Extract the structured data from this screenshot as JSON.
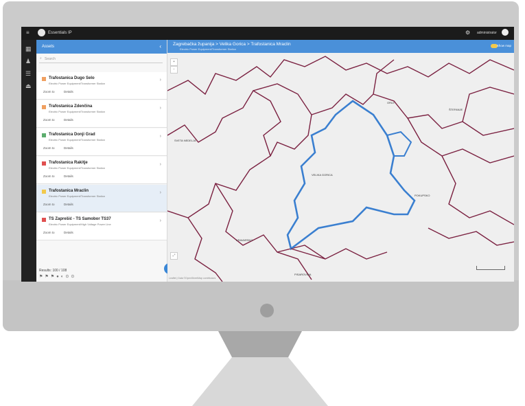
{
  "app": {
    "title": "Essentials IP",
    "user": "administrator"
  },
  "sidebar": {
    "title": "Assets",
    "search_placeholder": "Search",
    "items": [
      {
        "name": "Trafostanica Dugo Selo",
        "desc": "Electric Power Equipment/Transformer Station",
        "color": "#f0a060",
        "a1": "Zoom to",
        "a2": "Details"
      },
      {
        "name": "Trafostanica Zdenčina",
        "desc": "Electric Power Equipment/Transformer Station",
        "color": "#f0a060",
        "a1": "Zoom to",
        "a2": "Details"
      },
      {
        "name": "Trafostanica Donji Grad",
        "desc": "Electric Power Equipment/Transformer Station",
        "color": "#5cad6e",
        "a1": "Zoom to",
        "a2": "Details"
      },
      {
        "name": "Trafostanica Rakitje",
        "desc": "Electric Power Equipment/Transformer Station",
        "color": "#e05050",
        "a1": "Zoom to",
        "a2": "Details"
      },
      {
        "name": "Trafostanica Mraclin",
        "desc": "Electric Power Equipment/Transformer Station",
        "color": "#f2c94c",
        "a1": "Zoom to",
        "a2": "Details"
      },
      {
        "name": "TS Zaprešić - TS Samobor TS37",
        "desc": "Electric Power Equipment/High Voltage Power Line",
        "color": "#e05050",
        "a1": "Zoom to",
        "a2": "Details"
      }
    ],
    "results": "Results: 100 / 108"
  },
  "map": {
    "breadcrumb": "Zagrebačka županija > Velika Gorica > Trafostanica Mraclin",
    "subtitle": "Electric Power Equipment/Transformer Station",
    "toggle_label": "Show map",
    "footer": "Leaflet | Data ©OpenStreetMap contributors",
    "labels": [
      "VELIKA GORICA",
      "PISAROVINA",
      "ORLE",
      "KRAVARSKO",
      "POKUPSKO",
      "SVETA NEDELJA",
      "ŠTEFANJE"
    ]
  },
  "colors": {
    "accent": "#4a90d9",
    "border": "#7a2040",
    "highlight": "#3a7fd0"
  }
}
